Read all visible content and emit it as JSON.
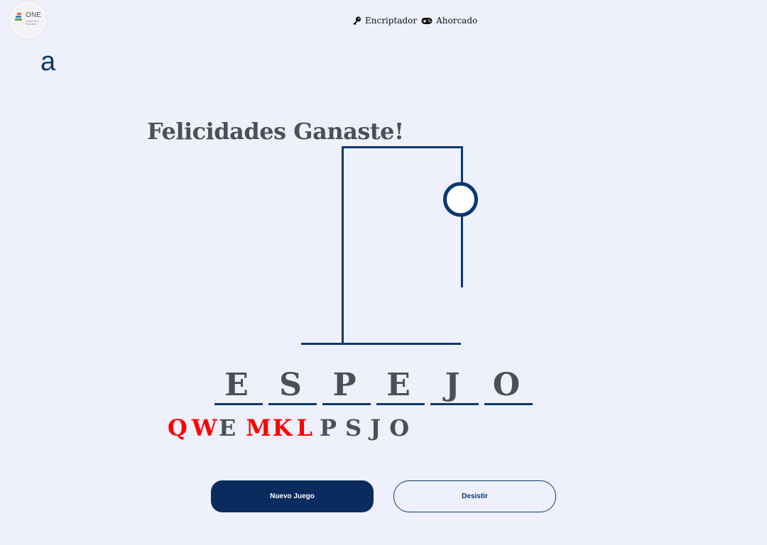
{
  "logos": {
    "one_title": "ONE",
    "one_subtitle": "Oracle Next Education",
    "alura_mark": "a"
  },
  "nav": {
    "items": [
      {
        "label": "Encriptador",
        "icon": "key-icon"
      },
      {
        "label": "Ahorcado",
        "icon": "gamepad-icon"
      }
    ]
  },
  "game": {
    "result_message": "Felicidades Ganaste!",
    "word": [
      "E",
      "S",
      "P",
      "E",
      "J",
      "O"
    ],
    "used_letters": [
      {
        "letter": "Q",
        "status": "wrong"
      },
      {
        "letter": "W",
        "status": "wrong"
      },
      {
        "letter": "E",
        "status": "right"
      },
      {
        "letter": "M",
        "status": "wrong"
      },
      {
        "letter": "K",
        "status": "wrong"
      },
      {
        "letter": "L",
        "status": "wrong"
      },
      {
        "letter": "P",
        "status": "right"
      },
      {
        "letter": "S",
        "status": "right"
      },
      {
        "letter": "J",
        "status": "right"
      },
      {
        "letter": "O",
        "status": "right"
      }
    ]
  },
  "buttons": {
    "new_game": "Nuevo Juego",
    "give_up": "Desistir"
  },
  "colors": {
    "background": "#eef0fb",
    "primary": "#0a3871",
    "text": "#495057",
    "wrong_letter": "#ff0000"
  }
}
